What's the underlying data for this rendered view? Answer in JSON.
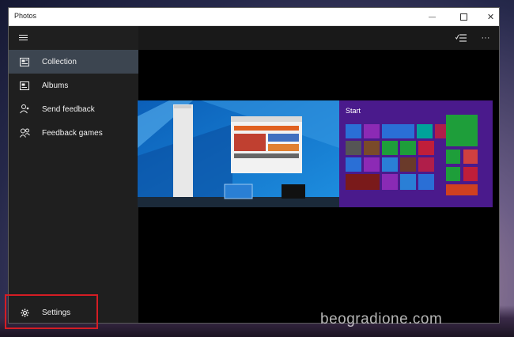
{
  "window": {
    "title": "Photos"
  },
  "controls": {
    "minimize": "—",
    "maximize": "☐",
    "close": "✕"
  },
  "sidebar": {
    "items": [
      {
        "label": "Collection",
        "icon": "collection-icon",
        "active": true
      },
      {
        "label": "Albums",
        "icon": "albums-icon",
        "active": false
      },
      {
        "label": "Send feedback",
        "icon": "feedback-icon",
        "active": false
      },
      {
        "label": "Feedback games",
        "icon": "people-icon",
        "active": false
      }
    ],
    "settings_label": "Settings"
  },
  "toolbar": {
    "more": "···"
  },
  "thumbnails": [
    {
      "icon": "windows10-screenshot-thumbnail"
    },
    {
      "icon": "windows8-start-screen-thumbnail",
      "caption": "Start"
    }
  ],
  "watermark": "beogradione.com",
  "colors": {
    "accent_selected": "#3c4550",
    "highlight_box": "#d41d24",
    "sidebar_bg": "#1f1f1f"
  }
}
